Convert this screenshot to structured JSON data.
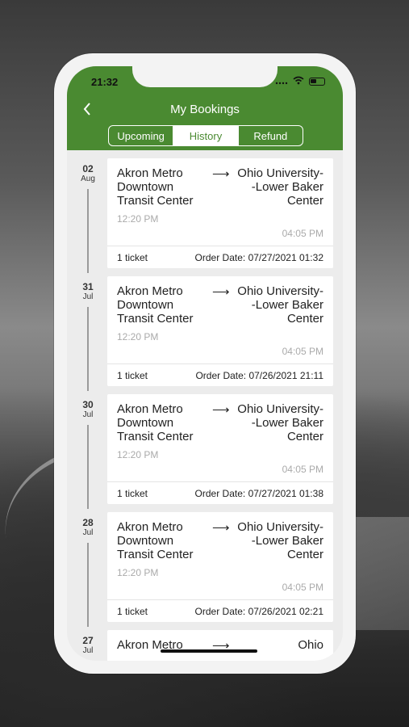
{
  "status_bar": {
    "time": "21:32"
  },
  "header": {
    "title": "My Bookings"
  },
  "tabs": [
    {
      "label": "Upcoming",
      "active": false
    },
    {
      "label": "History",
      "active": true
    },
    {
      "label": "Refund",
      "active": false
    }
  ],
  "bookings": [
    {
      "day": "02",
      "month": "Aug",
      "from": "Akron Metro Downtown Transit Center",
      "to": "Ohio University--Lower Baker Center",
      "departure": "12:20 PM",
      "arrival": "04:05 PM",
      "tickets": "1 ticket",
      "order_date": "Order Date: 07/27/2021 01:32"
    },
    {
      "day": "31",
      "month": "Jul",
      "from": "Akron Metro Downtown Transit Center",
      "to": "Ohio University--Lower Baker Center",
      "departure": "12:20 PM",
      "arrival": "04:05 PM",
      "tickets": "1 ticket",
      "order_date": "Order Date: 07/26/2021 21:11"
    },
    {
      "day": "30",
      "month": "Jul",
      "from": "Akron Metro Downtown Transit Center",
      "to": "Ohio University--Lower Baker Center",
      "departure": "12:20 PM",
      "arrival": "04:05 PM",
      "tickets": "1 ticket",
      "order_date": "Order Date: 07/27/2021 01:38"
    },
    {
      "day": "28",
      "month": "Jul",
      "from": "Akron Metro Downtown Transit Center",
      "to": "Ohio University--Lower Baker Center",
      "departure": "12:20 PM",
      "arrival": "04:05 PM",
      "tickets": "1 ticket",
      "order_date": "Order Date: 07/26/2021 02:21"
    },
    {
      "day": "27",
      "month": "Jul",
      "from": "Akron Metro",
      "to": "Ohio"
    }
  ],
  "colors": {
    "brand_green": "#4a8a31",
    "card_bg": "#ffffff",
    "list_bg": "#ececec"
  },
  "icons": {
    "back": "chevron-left-icon",
    "arrow": "long-arrow-right-icon"
  }
}
